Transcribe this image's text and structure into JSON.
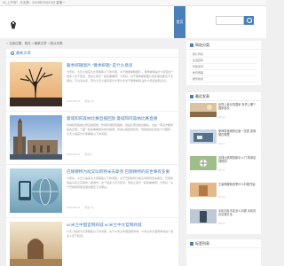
{
  "topbar": {
    "text": "Hi_上午好！今天是：2024年05月13日 星期一"
  },
  "header": {
    "nav_home": "首页",
    "search_placeholder": ""
  },
  "breadcrumb": {
    "text": "当前位置：首页 > 最新文章 > 默认列表"
  },
  "main": {
    "section_title": "最新文章",
    "posts": [
      {
        "title": "雅季邮箱图片 “雅季邮箱” 是什么意思",
        "excerpt": "大家好，今天小编来为大家解答以下的问题，关于雅季邮箱图片 ，雅季邮箱是什么意思这个很多人还不知道，现在让我们一起来看看吧！大家好，关于雅季邮箱图片很多朋友都还不太明白，不过没关系，因为今天小编就来为大家分享关于雅季邮箱 是什么意思的知识点。",
        "date": "2024-05-13",
        "views": "阅读 12"
      },
      {
        "title": "曼城和阿森纳比赛直播回放 曼城和阿森纳比赛直播",
        "excerpt": "曼城和阿森纳比赛直播回放，作者曼城和阿森纳，但是比赛也相当精彩，这是一场双方都想赢的比赛，下面一起来看看相关的内容吧！曼城以其控球优势，阿森纳的反击也十分犀利，今天小编来为大家解答以下的问题。",
        "date": "2024-05-13",
        "views": "阅读 9"
      },
      {
        "title": "巴赫穆特为啥又叫阿特米夫斯克 巴赫穆特的前世事有多重",
        "excerpt": "大家好，今天小编来为大家解答以下的问题，关于巴赫穆特为啥又叫阿特米夫斯克，巴赫穆特是乌克兰东部的一座城市，这个很多人还不知道，现在让我们一起来看看吧！大家好，关于巴赫穆特很多朋友都还不太明白。",
        "date": "2024-05-13",
        "views": "阅读 15"
      },
      {
        "title": "ac米兰中国官网商城 ac米兰中文官网商城",
        "excerpt": "今天小编来为大家解答以下的问题，关于ac米兰中国官网商城，ac米兰中文官网商城这个很多人还不知道。",
        "date": "2024-05-13",
        "views": "阅读 7"
      }
    ]
  },
  "sidebar": {
    "categories_title": "网站分类",
    "categories": [
      "默认列表",
      "生活百科",
      "科技资讯",
      "体育赛事",
      "娱乐新闻"
    ],
    "recent_title": "最近发表",
    "recent": [
      {
        "title": "世界上最长的国家 世界上哪个国家最长",
        "date": "05-13"
      },
      {
        "title": "原神蒙德城的位置一览表 蒙德城在哪里",
        "date": "05-13"
      },
      {
        "title": "足球比赛规则新手入门 简单足球规则",
        "date": "05-13"
      },
      {
        "title": "王者荣耀新赛季什么时候开始",
        "date": "05-13"
      },
      {
        "title": "手机内存不足怎么清理 手机内存清理方法",
        "date": "05-13"
      }
    ],
    "tags_title": "标签列表"
  },
  "colors": {
    "accent": "#4a7fb8",
    "background": "#f0f0f0"
  }
}
